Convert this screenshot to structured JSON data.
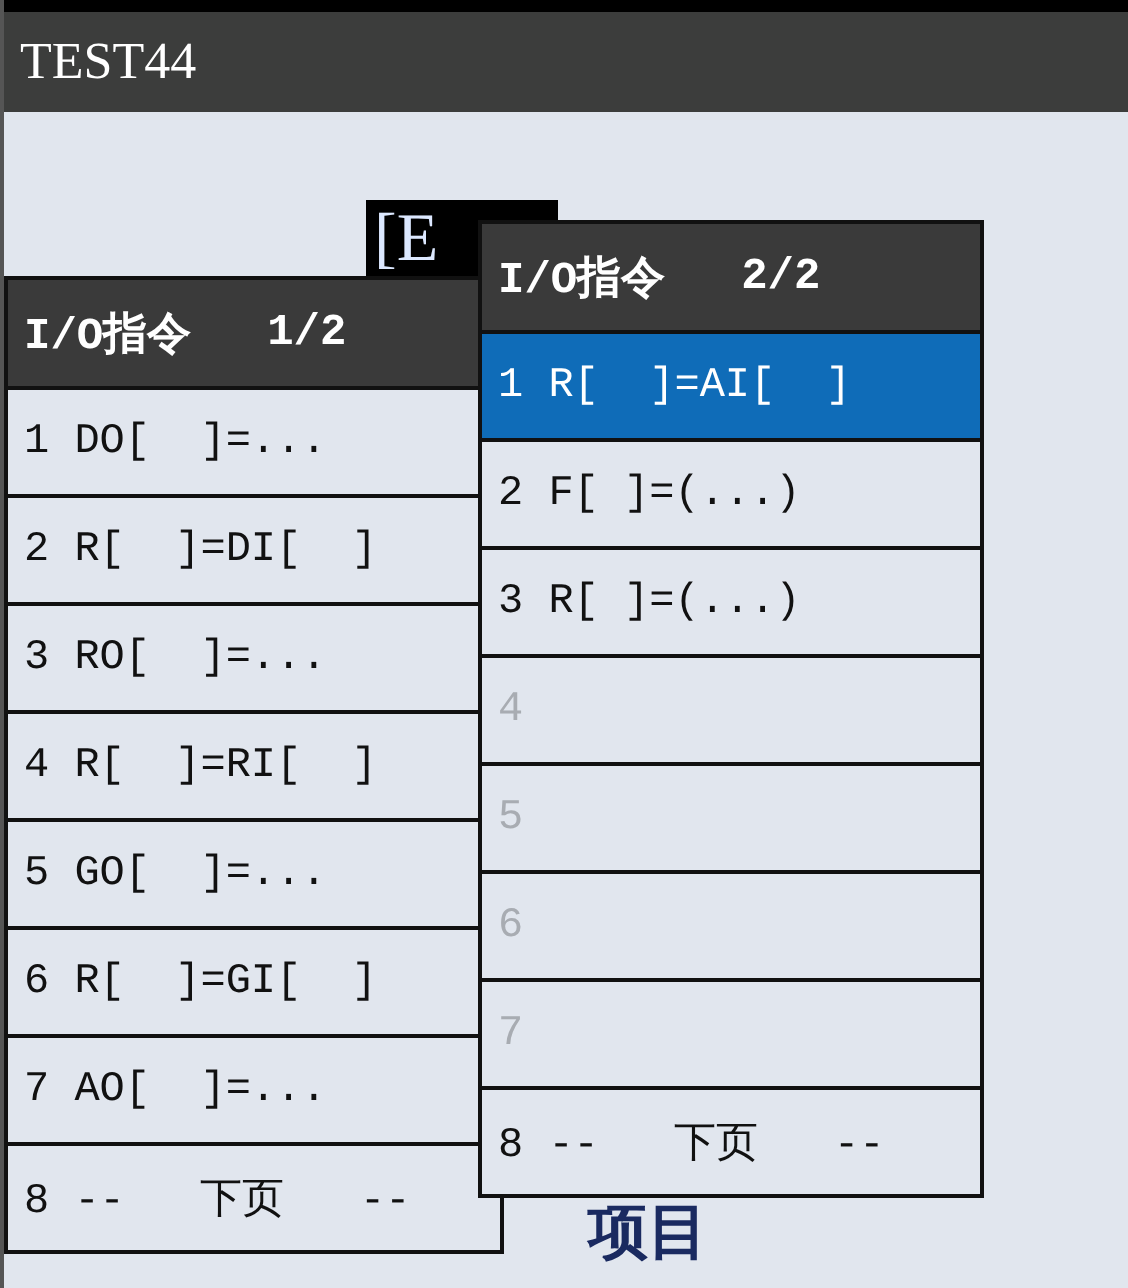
{
  "title": "TEST44",
  "background_texts": [
    {
      "kind": "tag",
      "text": "[E"
    },
    {
      "kind": "heading",
      "text": "项目"
    }
  ],
  "menus": [
    {
      "title": "I/O指令",
      "page": "1/2",
      "items": [
        {
          "label": "1 DO[  ]=...",
          "selected": false,
          "disabled": false
        },
        {
          "label": "2 R[  ]=DI[  ]",
          "selected": false,
          "disabled": false
        },
        {
          "label": "3 RO[  ]=...",
          "selected": false,
          "disabled": false
        },
        {
          "label": "4 R[  ]=RI[  ]",
          "selected": false,
          "disabled": false
        },
        {
          "label": "5 GO[  ]=...",
          "selected": false,
          "disabled": false
        },
        {
          "label": "6 R[  ]=GI[  ]",
          "selected": false,
          "disabled": false
        },
        {
          "label": "7 AO[  ]=...",
          "selected": false,
          "disabled": false
        },
        {
          "label": "8 --   下页   --",
          "selected": false,
          "disabled": false
        }
      ]
    },
    {
      "title": "I/O指令",
      "page": "2/2",
      "items": [
        {
          "label": "1 R[  ]=AI[  ]",
          "selected": true,
          "disabled": false
        },
        {
          "label": "2 F[ ]=(...)",
          "selected": false,
          "disabled": false
        },
        {
          "label": "3 R[ ]=(...)",
          "selected": false,
          "disabled": false
        },
        {
          "label": "4",
          "selected": false,
          "disabled": true
        },
        {
          "label": "5",
          "selected": false,
          "disabled": true
        },
        {
          "label": "6",
          "selected": false,
          "disabled": true
        },
        {
          "label": "7",
          "selected": false,
          "disabled": true
        },
        {
          "label": "8 --   下页   --",
          "selected": false,
          "disabled": false
        }
      ]
    }
  ]
}
